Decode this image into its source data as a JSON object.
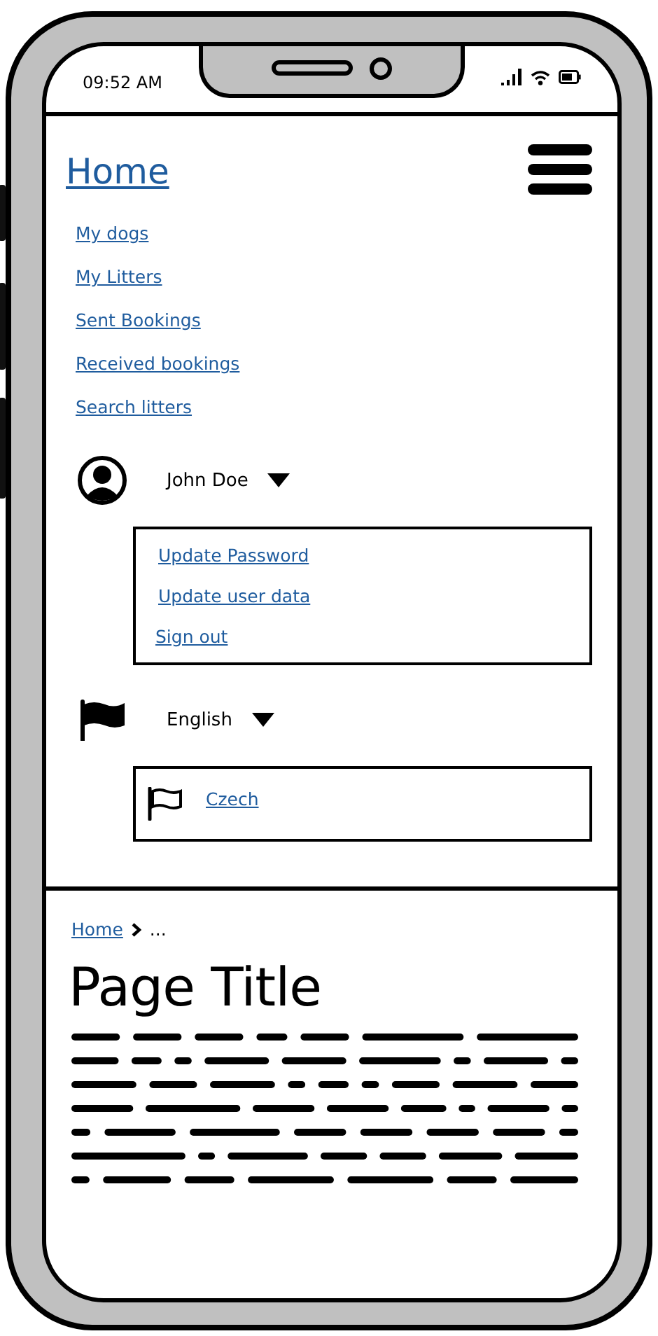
{
  "status_bar": {
    "time": "09:52 AM"
  },
  "header": {
    "title": "Home"
  },
  "nav": [
    {
      "label": "My dogs"
    },
    {
      "label": "My Litters"
    },
    {
      "label": "Sent Bookings"
    },
    {
      "label": "Received bookings"
    },
    {
      "label": "Search litters"
    }
  ],
  "user_menu": {
    "name": "John Doe",
    "expanded": true,
    "items": [
      "Update Password",
      "Update user data",
      "Sign out"
    ]
  },
  "language_menu": {
    "current": "English",
    "expanded": true,
    "options": [
      "Czech"
    ]
  },
  "breadcrumb": [
    {
      "label": "Home",
      "link": true
    },
    {
      "label": "...",
      "link": false
    }
  ],
  "page": {
    "title": "Page Title"
  }
}
